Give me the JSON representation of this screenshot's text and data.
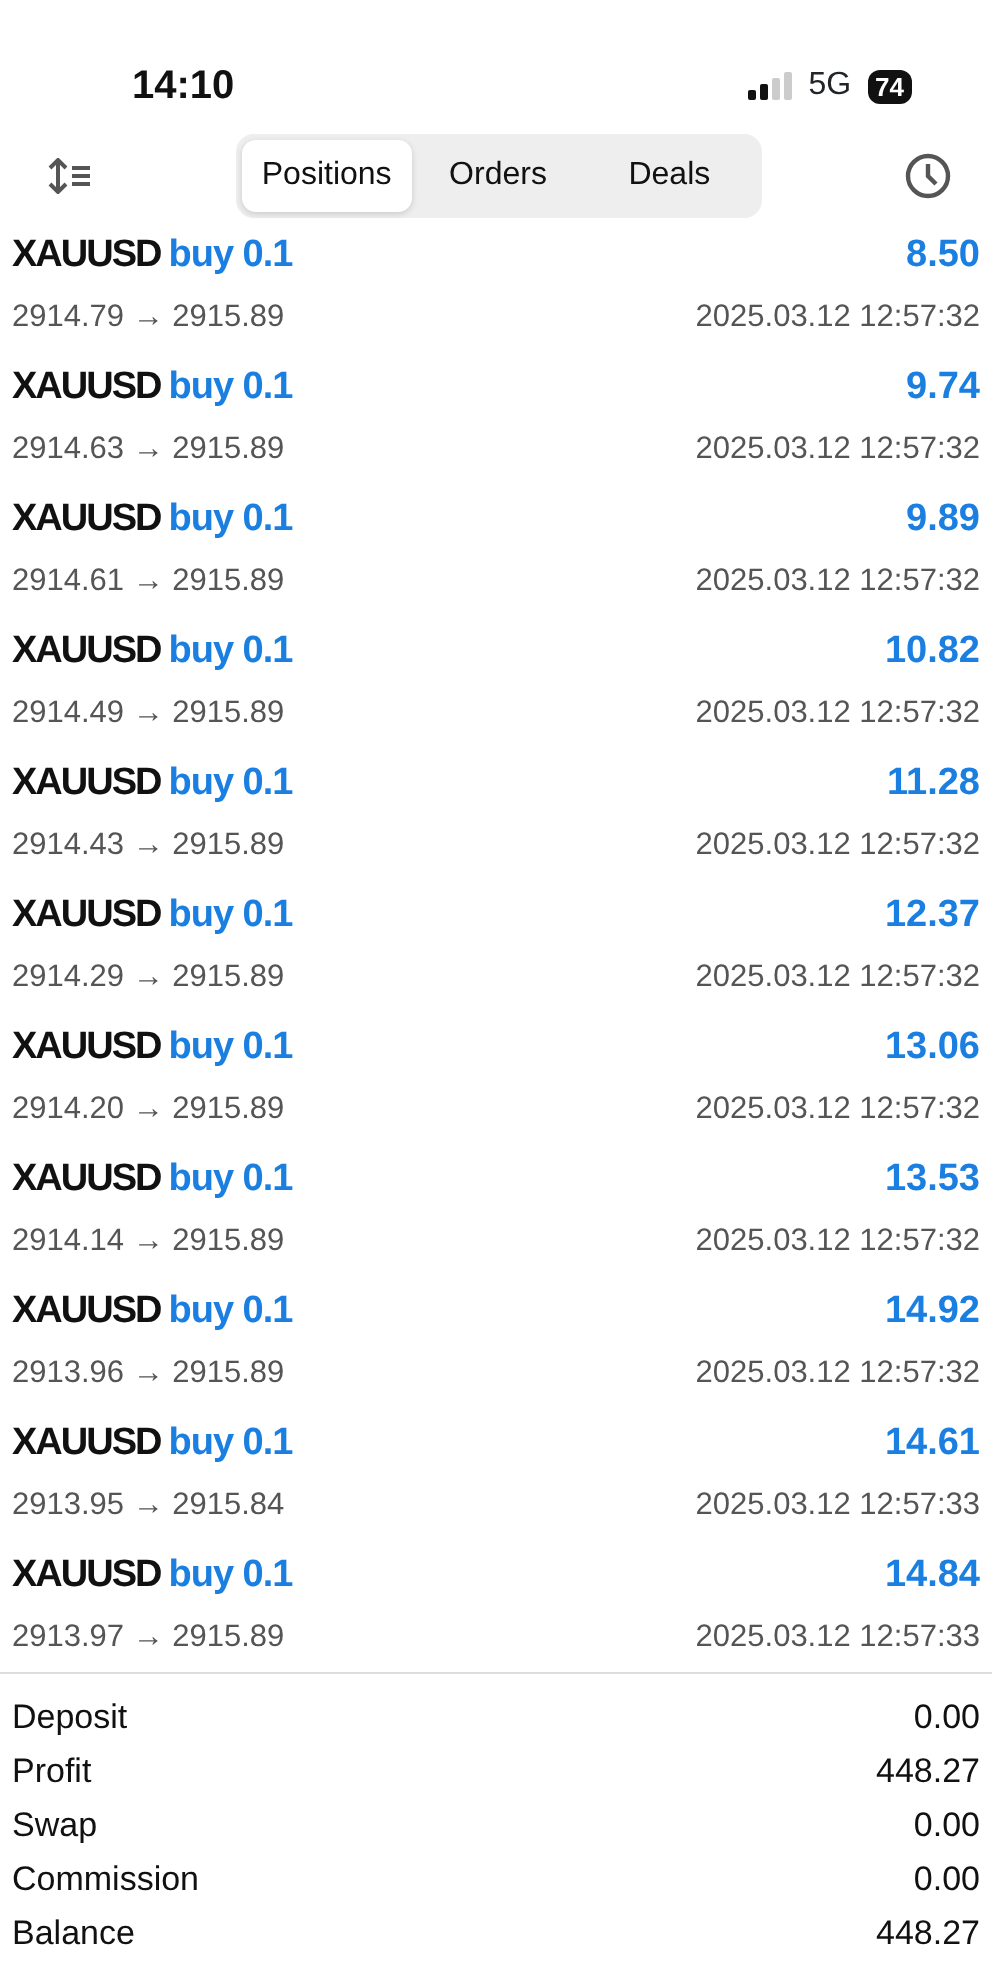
{
  "status_bar": {
    "time": "14:10",
    "network": "5G",
    "battery": "74"
  },
  "tabs": [
    {
      "label": "Positions",
      "selected": true
    },
    {
      "label": "Orders",
      "selected": false
    },
    {
      "label": "Deals",
      "selected": false
    }
  ],
  "positions": [
    {
      "symbol": "XAUUSD",
      "order": "buy 0.1",
      "profit": "8.50",
      "prices": "2914.79 → 2915.89",
      "time": "2025.03.12 12:57:32"
    },
    {
      "symbol": "XAUUSD",
      "order": "buy 0.1",
      "profit": "9.74",
      "prices": "2914.63 → 2915.89",
      "time": "2025.03.12 12:57:32"
    },
    {
      "symbol": "XAUUSD",
      "order": "buy 0.1",
      "profit": "9.89",
      "prices": "2914.61 → 2915.89",
      "time": "2025.03.12 12:57:32"
    },
    {
      "symbol": "XAUUSD",
      "order": "buy 0.1",
      "profit": "10.82",
      "prices": "2914.49 → 2915.89",
      "time": "2025.03.12 12:57:32"
    },
    {
      "symbol": "XAUUSD",
      "order": "buy 0.1",
      "profit": "11.28",
      "prices": "2914.43 → 2915.89",
      "time": "2025.03.12 12:57:32"
    },
    {
      "symbol": "XAUUSD",
      "order": "buy 0.1",
      "profit": "12.37",
      "prices": "2914.29 → 2915.89",
      "time": "2025.03.12 12:57:32"
    },
    {
      "symbol": "XAUUSD",
      "order": "buy 0.1",
      "profit": "13.06",
      "prices": "2914.20 → 2915.89",
      "time": "2025.03.12 12:57:32"
    },
    {
      "symbol": "XAUUSD",
      "order": "buy 0.1",
      "profit": "13.53",
      "prices": "2914.14 → 2915.89",
      "time": "2025.03.12 12:57:32"
    },
    {
      "symbol": "XAUUSD",
      "order": "buy 0.1",
      "profit": "14.92",
      "prices": "2913.96 → 2915.89",
      "time": "2025.03.12 12:57:32"
    },
    {
      "symbol": "XAUUSD",
      "order": "buy 0.1",
      "profit": "14.61",
      "prices": "2913.95 → 2915.84",
      "time": "2025.03.12 12:57:33"
    },
    {
      "symbol": "XAUUSD",
      "order": "buy 0.1",
      "profit": "14.84",
      "prices": "2913.97 → 2915.89",
      "time": "2025.03.12 12:57:33"
    }
  ],
  "summary": [
    {
      "label": "Deposit",
      "value": "0.00"
    },
    {
      "label": "Profit",
      "value": "448.27"
    },
    {
      "label": "Swap",
      "value": "0.00"
    },
    {
      "label": "Commission",
      "value": "0.00"
    },
    {
      "label": "Balance",
      "value": "448.27"
    }
  ]
}
